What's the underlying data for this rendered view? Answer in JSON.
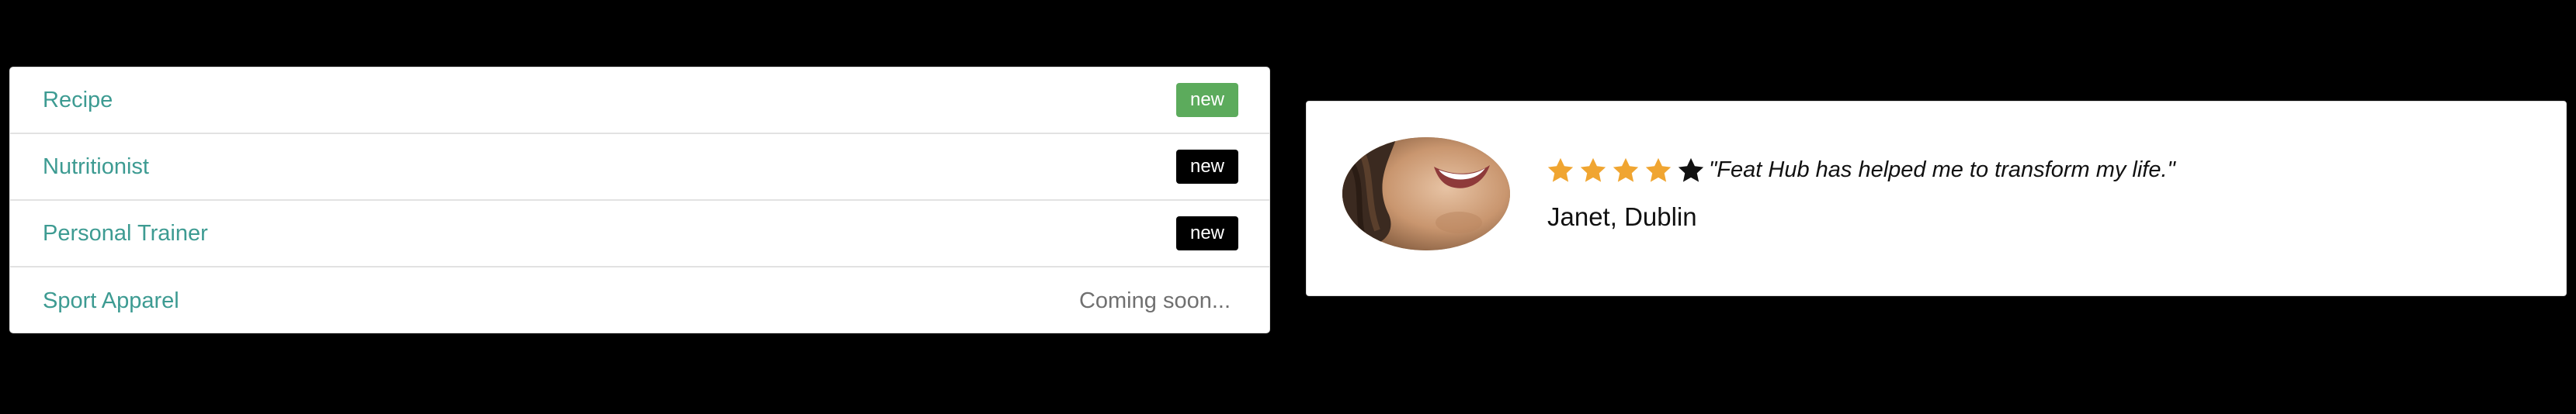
{
  "services": {
    "items": [
      {
        "label": "Recipe",
        "status": "new",
        "status_style": "green"
      },
      {
        "label": "Nutritionist",
        "status": "new",
        "status_style": "black"
      },
      {
        "label": "Personal Trainer",
        "status": "new",
        "status_style": "black"
      },
      {
        "label": "Sport Apparel",
        "status": "Coming soon...",
        "status_style": "text"
      }
    ]
  },
  "testimonial": {
    "avatar_icon": "woman-smiling-photo",
    "rating": 4,
    "rating_max": 5,
    "quote": "\"Feat Hub has helped me to transform my life.\"",
    "author": "Janet, Dublin"
  },
  "colors": {
    "link": "#3d9b92",
    "badge_green": "#5cab5c",
    "badge_black": "#000000",
    "star_filled": "#f0a531",
    "star_empty": "#111111",
    "background": "#000000"
  }
}
